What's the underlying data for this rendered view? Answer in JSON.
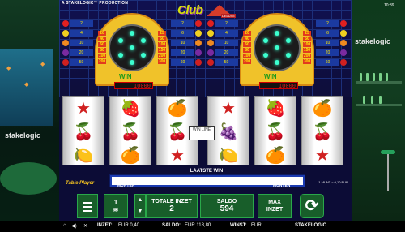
{
  "topbar": {
    "production": "A STAKELOGIC™ PRODUCTION",
    "clock": "10:39"
  },
  "logo": {
    "text": "Club",
    "sub": "DELUXE"
  },
  "machines": [
    {
      "win_label": "WIN",
      "win_value": "10000",
      "ladder_left": [
        "20",
        "40",
        "60",
        "80",
        "100",
        "200"
      ],
      "ladder_right": [
        "25",
        "50",
        "100",
        "150",
        "200",
        "300"
      ],
      "rows_left": [
        "2",
        "4",
        "10",
        "20",
        "50"
      ],
      "rows_right": [
        "2",
        "6",
        "10",
        "20",
        "60"
      ]
    },
    {
      "win_label": "WIN",
      "win_value": "10000",
      "ladder_left": [
        "20",
        "40",
        "60",
        "80",
        "100",
        "200"
      ],
      "ladder_right": [
        "25",
        "50",
        "100",
        "150",
        "200",
        "300"
      ],
      "rows_left": [
        "2",
        "4",
        "10",
        "20",
        "50"
      ],
      "rows_right": [
        "2",
        "6",
        "10",
        "20",
        "60"
      ]
    }
  ],
  "reels_a": [
    [
      "★",
      "🍒",
      "🍋"
    ],
    [
      "🍓",
      "🍒",
      "🍊"
    ],
    [
      "🍊",
      "🍒",
      "★"
    ]
  ],
  "reels_b": [
    [
      "★",
      "🍇",
      "🍋"
    ],
    [
      "🍓",
      "🍒",
      "🍊"
    ],
    [
      "🍊",
      "🍒",
      "★"
    ]
  ],
  "arrow_label": "WIN LINE",
  "last_win": {
    "title": "LAATSTE WIN",
    "munten_left": "MUNTEN",
    "munten_right": "MUNTEN"
  },
  "table_game": "Table Player",
  "munt_info": "1 MUNT = 0,10 EUR",
  "controls": {
    "coins": "1",
    "totale_label": "TOTALE INZET",
    "totale_value": "2",
    "saldo_label": "SALDO",
    "saldo_value": "594",
    "max_label": "MAX",
    "max_label2": "INZET"
  },
  "side": {
    "logo_left": "stakelogic",
    "logo_right": "stakelogic"
  },
  "status": {
    "inzet_label": "INZET:",
    "inzet_value": "EUR 0,40",
    "saldo_label": "SALDO:",
    "saldo_value": "EUR 118,80",
    "winst_label": "WINST:",
    "winst_value": "EUR",
    "brand": "STAKELOGIC"
  },
  "colors": {
    "accent_green": "#2aa84a",
    "reel_bg": "#ffffff",
    "arch": "#f0c22a"
  }
}
